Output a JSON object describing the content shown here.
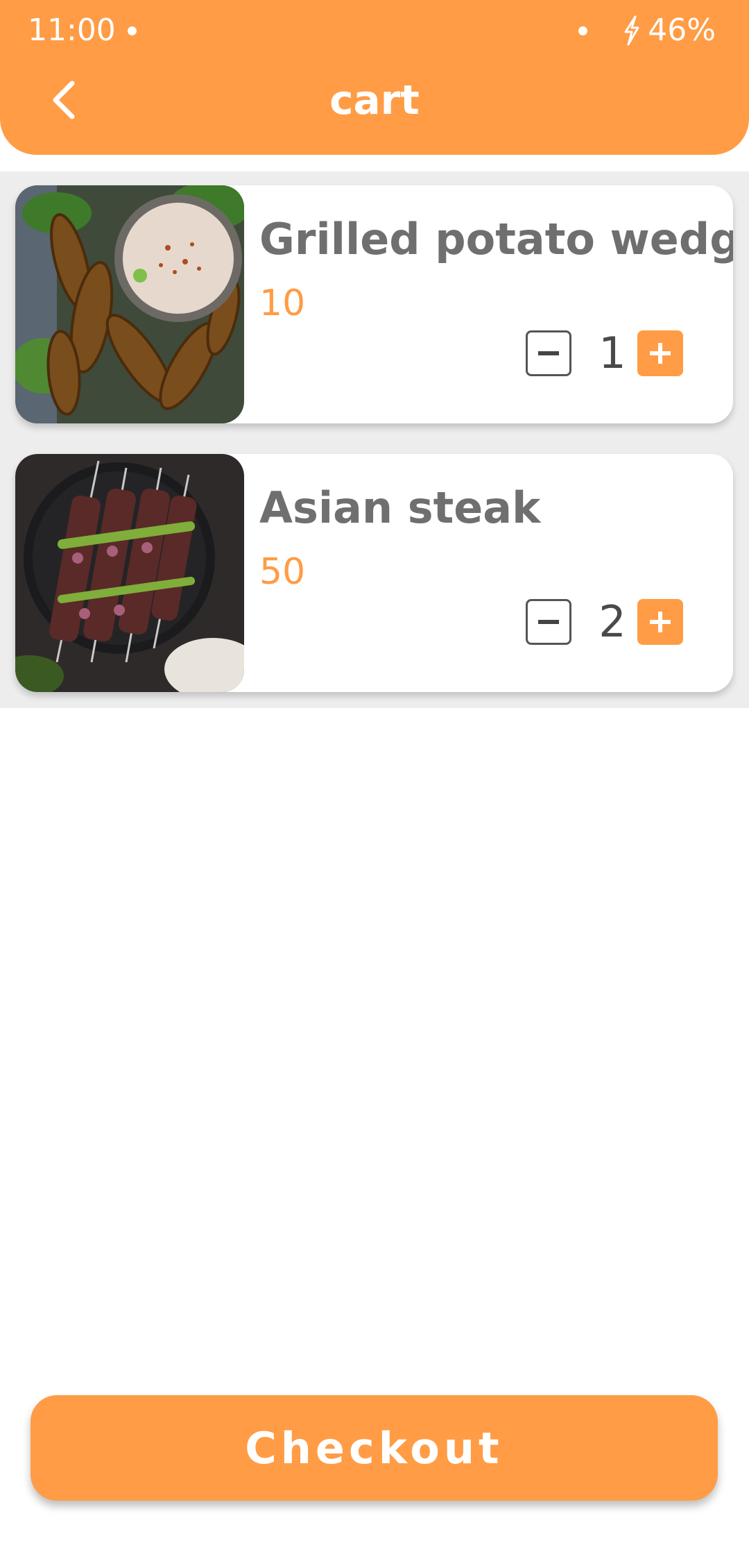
{
  "status_bar": {
    "time": "11:00",
    "battery": "46%"
  },
  "header": {
    "title": "cart"
  },
  "cart": {
    "items": [
      {
        "name": "Grilled potato wedge fries",
        "price": "10",
        "quantity": "1"
      },
      {
        "name": "Asian steak",
        "price": "50",
        "quantity": "2"
      }
    ]
  },
  "checkout": {
    "label": "Checkout"
  },
  "colors": {
    "accent": "#FF9C45",
    "text_gray": "#6f6f6f",
    "list_bg": "#ededed"
  }
}
